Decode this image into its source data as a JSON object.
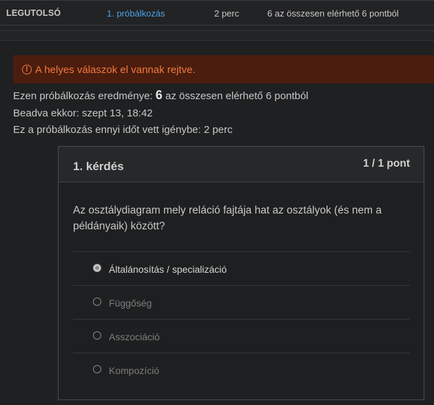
{
  "attempt_table": {
    "label": "LEGUTOLSÓ",
    "attempt_link": "1. próbálkozás",
    "time": "2 perc",
    "score": "6 az összesen elérhető 6 pontból"
  },
  "alert": {
    "icon": "exclamation-circle-icon",
    "text": "A helyes válaszok el vannak rejtve.",
    "color": "#f2793e",
    "background": "#4a1d0e"
  },
  "summary": {
    "result_prefix": "Ezen próbálkozás eredménye:",
    "result_score": "6",
    "result_suffix": "az összesen elérhető 6 pontból",
    "submitted": "Beadva ekkor: szept 13, 18:42",
    "duration": "Ez a próbálkozás ennyi időt vett igénybe: 2 perc"
  },
  "question": {
    "title": "1. kérdés",
    "points": "1 / 1 pont",
    "text": "Az osztálydiagram mely reláció fajtája hat az osztályok (és nem a példányaik) között?",
    "answers": [
      {
        "label": "Általánosítás / specializáció",
        "selected": true
      },
      {
        "label": "Függőség",
        "selected": false
      },
      {
        "label": "Asszociáció",
        "selected": false
      },
      {
        "label": "Kompozíció",
        "selected": false
      }
    ]
  }
}
